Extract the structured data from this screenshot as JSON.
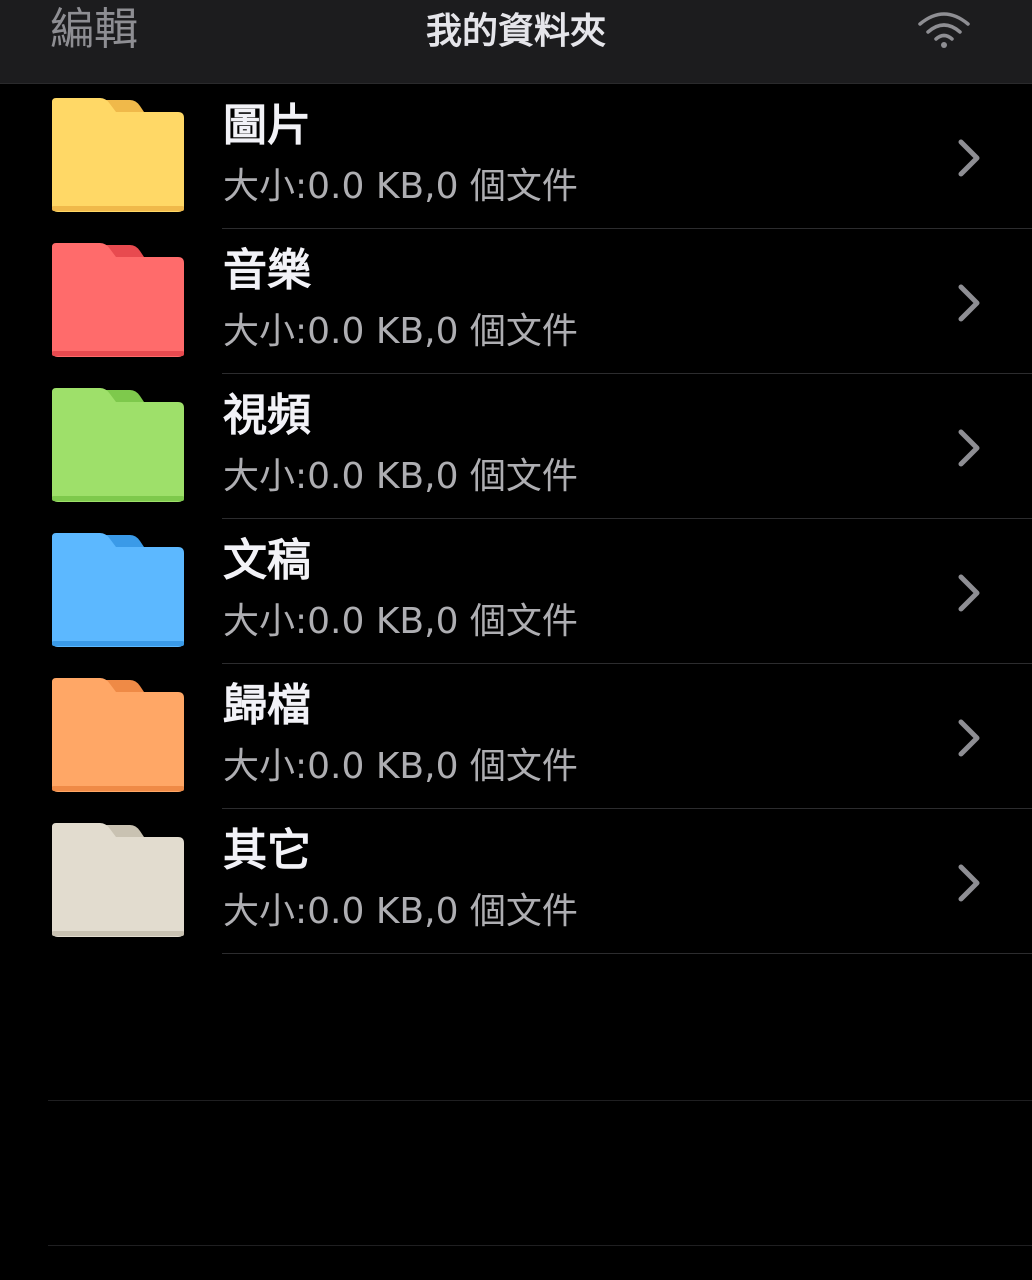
{
  "navbar": {
    "edit_label": "編輯",
    "title": "我的資料夾",
    "wifi_icon": "wifi-icon"
  },
  "colors": {
    "background": "#000000",
    "navbar": "#1c1c1e",
    "folder_pictures": "#ffd866",
    "folder_music": "#ff6b6b",
    "folder_videos": "#9ee06a",
    "folder_documents": "#5cb8ff",
    "folder_archives": "#ffa766",
    "folder_other": "#e2dccf"
  },
  "folders": [
    {
      "name": "圖片",
      "info": "大小:0.0 KB,0 個文件",
      "icon": "folder-yellow-icon"
    },
    {
      "name": "音樂",
      "info": "大小:0.0 KB,0 個文件",
      "icon": "folder-red-icon"
    },
    {
      "name": "視頻",
      "info": "大小:0.0 KB,0 個文件",
      "icon": "folder-green-icon"
    },
    {
      "name": "文稿",
      "info": "大小:0.0 KB,0 個文件",
      "icon": "folder-blue-icon"
    },
    {
      "name": "歸檔",
      "info": "大小:0.0 KB,0 個文件",
      "icon": "folder-orange-icon"
    },
    {
      "name": "其它",
      "info": "大小:0.0 KB,0 個文件",
      "icon": "folder-beige-icon"
    }
  ]
}
